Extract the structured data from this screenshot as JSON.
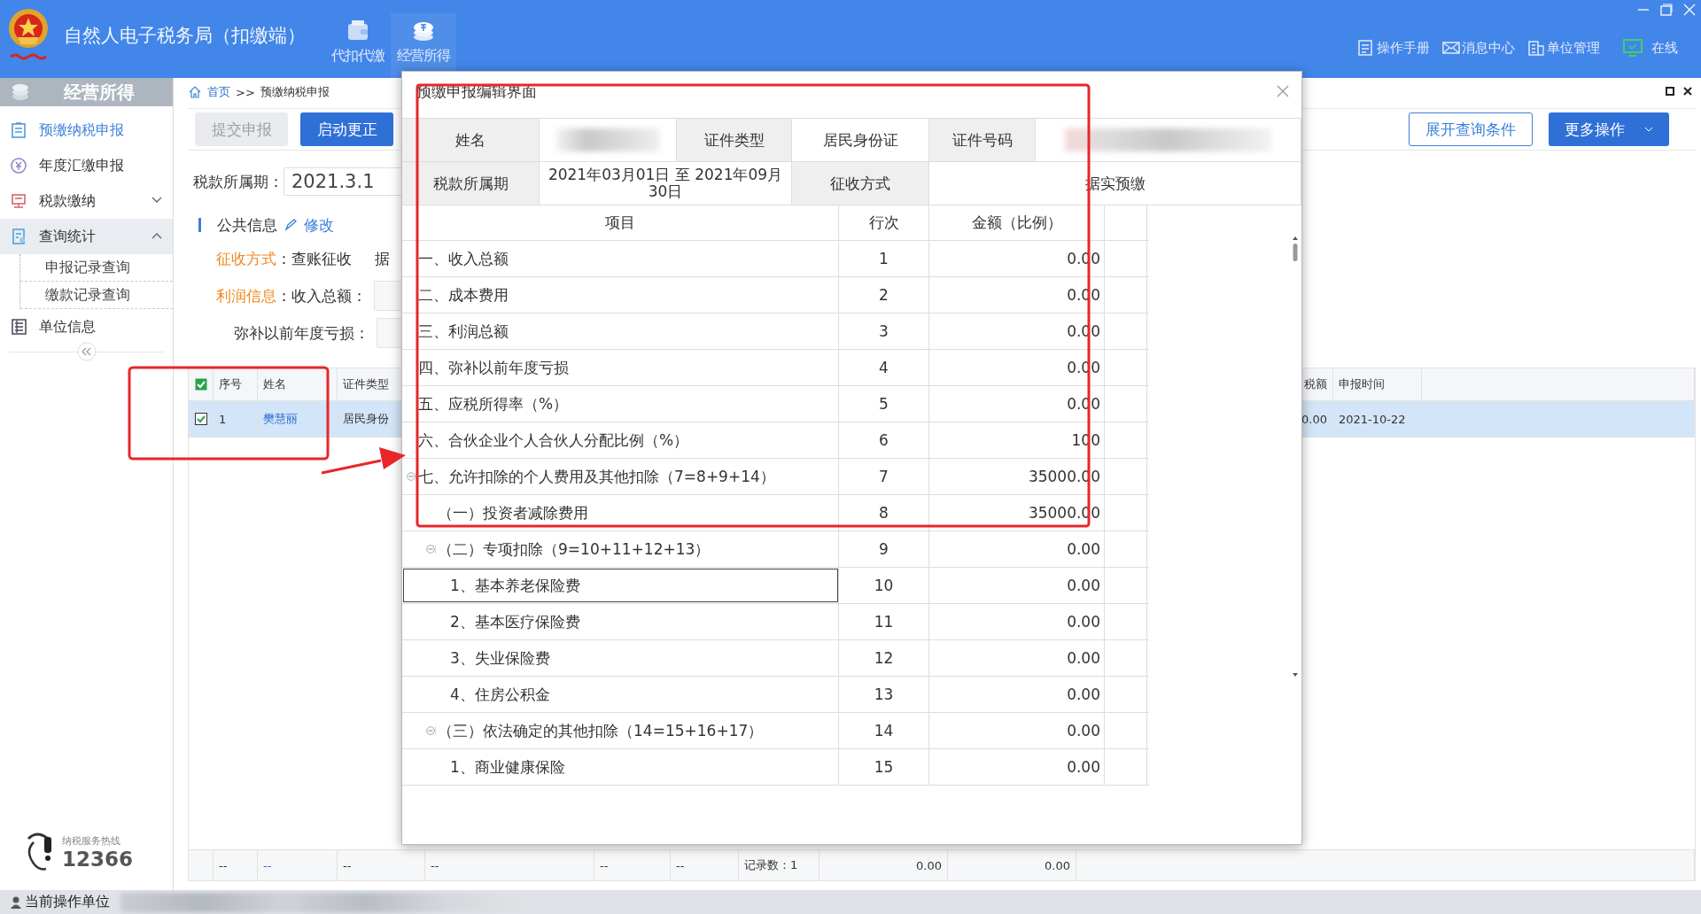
{
  "app": {
    "title": "自然人电子税务局（扣缴端）",
    "nav": [
      {
        "label": "代扣代缴",
        "selected": false
      },
      {
        "label": "经营所得",
        "selected": true
      }
    ],
    "links": [
      {
        "label": "操作手册"
      },
      {
        "label": "消息中心"
      },
      {
        "label": "单位管理"
      }
    ],
    "online": "在线"
  },
  "sidebar": {
    "title": "经营所得",
    "items": [
      {
        "kind": "item",
        "label": "预缴纳税申报",
        "selected": true
      },
      {
        "kind": "item",
        "label": "年度汇缴申报",
        "selected": false
      },
      {
        "kind": "group",
        "label": "税款缴纳",
        "selected": false,
        "expanded": false
      },
      {
        "kind": "group",
        "label": "查询统计",
        "selected": false,
        "expanded": true,
        "children": [
          {
            "label": "申报记录查询",
            "selected": false
          },
          {
            "label": "缴款记录查询",
            "selected": false
          }
        ]
      },
      {
        "kind": "item",
        "label": "单位信息",
        "selected": false
      }
    ],
    "hotline": {
      "label": "纳税服务热线",
      "number": "12366"
    }
  },
  "breadcrumb": {
    "home": "首页",
    "separator": ">>",
    "current": "预缴纳税申报"
  },
  "toolbar": {
    "buttons": [
      {
        "label": "提交申报",
        "disabled": true
      },
      {
        "label": "启动更正",
        "disabled": false
      }
    ],
    "right_buttons": [
      {
        "label": "展开查询条件",
        "kind": "outline"
      },
      {
        "label": "更多操作",
        "kind": "dropdown"
      }
    ]
  },
  "form": {
    "period_label": "税款所属期：",
    "period_value": "2021.3.1",
    "section": "公共信息",
    "edit_link": "修改",
    "fields": [
      {
        "label": "征收方式",
        "text": "：查账征收",
        "extra": "据",
        "has_input": false
      },
      {
        "label": "利润信息",
        "text": "：收入总额：",
        "has_input": true
      },
      {
        "text": "弥补以前年度亏损：",
        "has_input": true
      }
    ]
  },
  "table": {
    "all_checked": true,
    "columns": [
      "序号",
      "姓名",
      "证件类型",
      "税额",
      "申报时间"
    ],
    "rows": [
      {
        "checked": true,
        "selected": true,
        "cells": [
          "1",
          "樊慧丽",
          "居民身份",
          "0.00",
          "2021-10-22"
        ]
      }
    ],
    "footer": [
      "--",
      "--",
      "--",
      "--",
      "--",
      "--",
      "记录数：1",
      "0.00",
      "0.00"
    ]
  },
  "status_bar": {
    "label": "当前操作单位"
  },
  "modal": {
    "title": "预缴申报编辑界面",
    "info": [
      [
        {
          "kind": "label",
          "text": "姓名"
        },
        {
          "kind": "redacted"
        },
        {
          "kind": "label",
          "text": "证件类型"
        },
        {
          "kind": "value",
          "text": "居民身份证"
        },
        {
          "kind": "label",
          "text": "证件号码"
        },
        {
          "kind": "redacted"
        }
      ],
      [
        {
          "kind": "label",
          "text": "税款所属期"
        },
        {
          "kind": "value",
          "text": "2021年03月01日 至 2021年09月30日"
        },
        {
          "kind": "label",
          "text": "征收方式"
        },
        {
          "kind": "value",
          "text": "据实预缴"
        }
      ]
    ],
    "columns": [
      "项目",
      "行次",
      "金额（比例）"
    ],
    "rows": [
      {
        "item": "一、收入总额",
        "line": "1",
        "amount": "0.00",
        "selected": false
      },
      {
        "item": "二、成本费用",
        "line": "2",
        "amount": "0.00",
        "selected": false
      },
      {
        "item": "三、利润总额",
        "line": "3",
        "amount": "0.00",
        "selected": false
      },
      {
        "item": "四、弥补以前年度亏损",
        "line": "4",
        "amount": "0.00",
        "selected": false
      },
      {
        "item": "五、应税所得率（%）",
        "line": "5",
        "amount": "0.00",
        "selected": false
      },
      {
        "item": "六、合伙企业个人合伙人分配比例（%）",
        "line": "6",
        "amount": "100",
        "selected": false
      },
      {
        "item": "七、允许扣除的个人费用及其他扣除（7=8+9+14）",
        "line": "7",
        "amount": "35000.00",
        "selected": false,
        "expanded": true,
        "children": [
          {
            "item": "（一）投资者减除费用",
            "line": "8",
            "amount": "35000.00",
            "selected": false
          },
          {
            "item": "（二）专项扣除（9=10+11+12+13）",
            "line": "9",
            "amount": "0.00",
            "selected": false,
            "expanded": true,
            "children": [
              {
                "item": "1、基本养老保险费",
                "line": "10",
                "amount": "0.00",
                "selected": true
              },
              {
                "item": "2、基本医疗保险费",
                "line": "11",
                "amount": "0.00",
                "selected": false
              },
              {
                "item": "3、失业保险费",
                "line": "12",
                "amount": "0.00",
                "selected": false
              },
              {
                "item": "4、住房公积金",
                "line": "13",
                "amount": "0.00",
                "selected": false
              }
            ]
          },
          {
            "item": "（三）依法确定的其他扣除（14=15+16+17）",
            "line": "14",
            "amount": "0.00",
            "selected": false,
            "expanded": true,
            "children": [
              {
                "item": "1、商业健康保险",
                "line": "15",
                "amount": "0.00",
                "selected": false
              }
            ]
          }
        ]
      }
    ]
  }
}
